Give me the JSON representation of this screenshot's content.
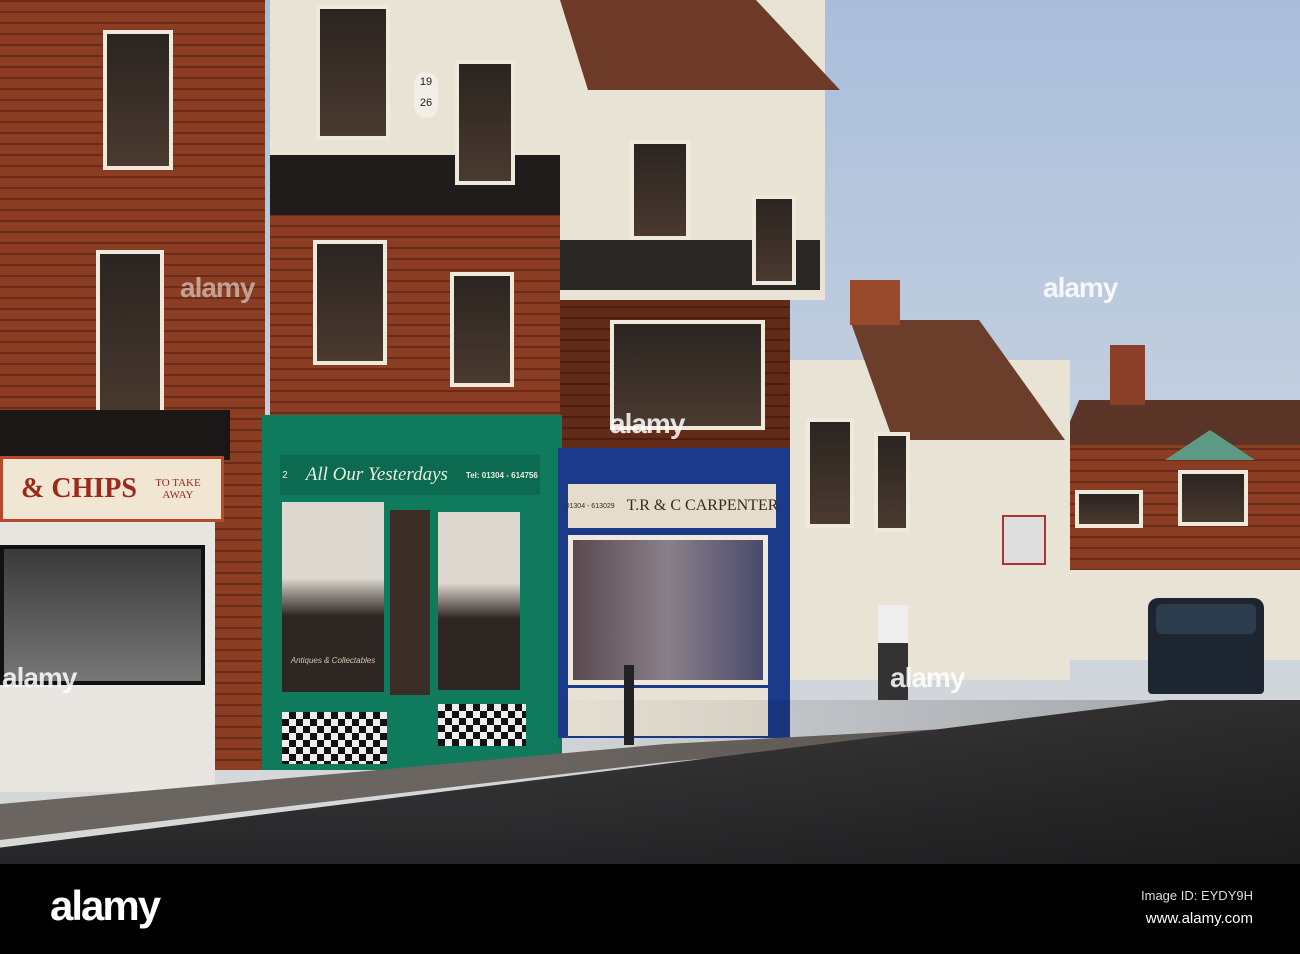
{
  "building_date": {
    "top": "19",
    "bottom": "26"
  },
  "chip_shop": {
    "name": "& CHIPS",
    "tagline": "TO TAKE AWAY"
  },
  "antique_shop": {
    "number": "2",
    "name": "All Our Yesterdays",
    "phone": "Tel: 01304 - 614756",
    "window_text": "Antiques & Collectables"
  },
  "carpenter_shop": {
    "name": "T.R & C CARPENTER",
    "phone": "01304 - 613029"
  },
  "watermark": {
    "text": "alamy"
  },
  "footer": {
    "logo": "alamy",
    "image_id": "Image ID: EYDY9H",
    "url": "www.alamy.com"
  },
  "colors": {
    "sky": "#a9bedb",
    "brick": "#8a3d23",
    "green": "#0f7a5c",
    "blue": "#1c3a8a"
  }
}
